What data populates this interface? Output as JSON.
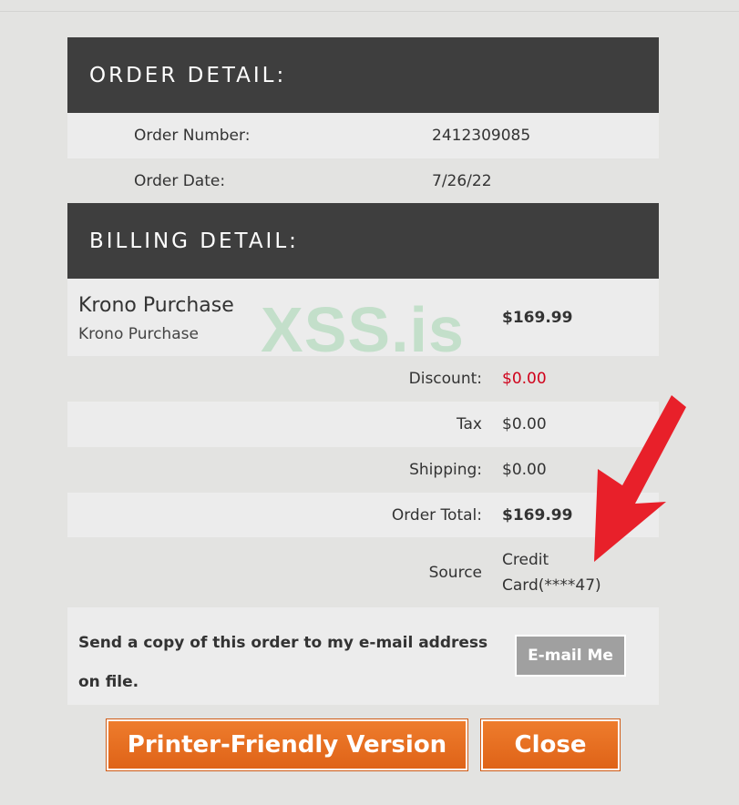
{
  "order_detail": {
    "header": "ORDER DETAIL:",
    "order_number_label": "Order Number:",
    "order_number": "2412309085",
    "order_date_label": "Order Date:",
    "order_date": "7/26/22"
  },
  "billing_detail": {
    "header": "BILLING DETAIL:",
    "item_name": "Krono Purchase",
    "item_desc": "Krono Purchase",
    "item_price": "$169.99",
    "discount_label": "Discount:",
    "discount_value": "$0.00",
    "tax_label": "Tax",
    "tax_value": "$0.00",
    "shipping_label": "Shipping:",
    "shipping_value": "$0.00",
    "total_label": "Order Total:",
    "total_value": "$169.99",
    "source_label": "Source",
    "source_value_line1": "Credit",
    "source_value_line2": "Card(****47)"
  },
  "email": {
    "text_line1": "Send a copy of this order to my e-mail address",
    "text_line2": "on file.",
    "button_label": "E-mail Me"
  },
  "actions": {
    "print_label": "Printer-Friendly Version",
    "close_label": "Close"
  },
  "watermark": "XSS.is",
  "colors": {
    "header_bg": "#3e3e3e",
    "discount": "#d0021b",
    "button_orange": "#e86f22",
    "button_gray": "#a0a0a0",
    "arrow": "#e8202a"
  }
}
